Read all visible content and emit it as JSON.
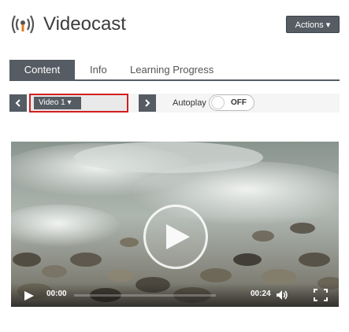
{
  "header": {
    "title": "Videocast",
    "actions_label": "Actions ▾"
  },
  "tabs": [
    {
      "label": "Content"
    },
    {
      "label": "Info"
    },
    {
      "label": "Learning Progress"
    }
  ],
  "controls": {
    "prev_icon": "chevron-left-icon",
    "next_icon": "chevron-right-icon",
    "video_select_value": "Video 1 ▾",
    "autoplay_label": "Autoplay",
    "autoplay_state": "OFF"
  },
  "player": {
    "current_time": "00:00",
    "duration": "00:24",
    "progress": 0
  },
  "colors": {
    "accent": "#555c63",
    "highlight": "#d21f1f"
  }
}
